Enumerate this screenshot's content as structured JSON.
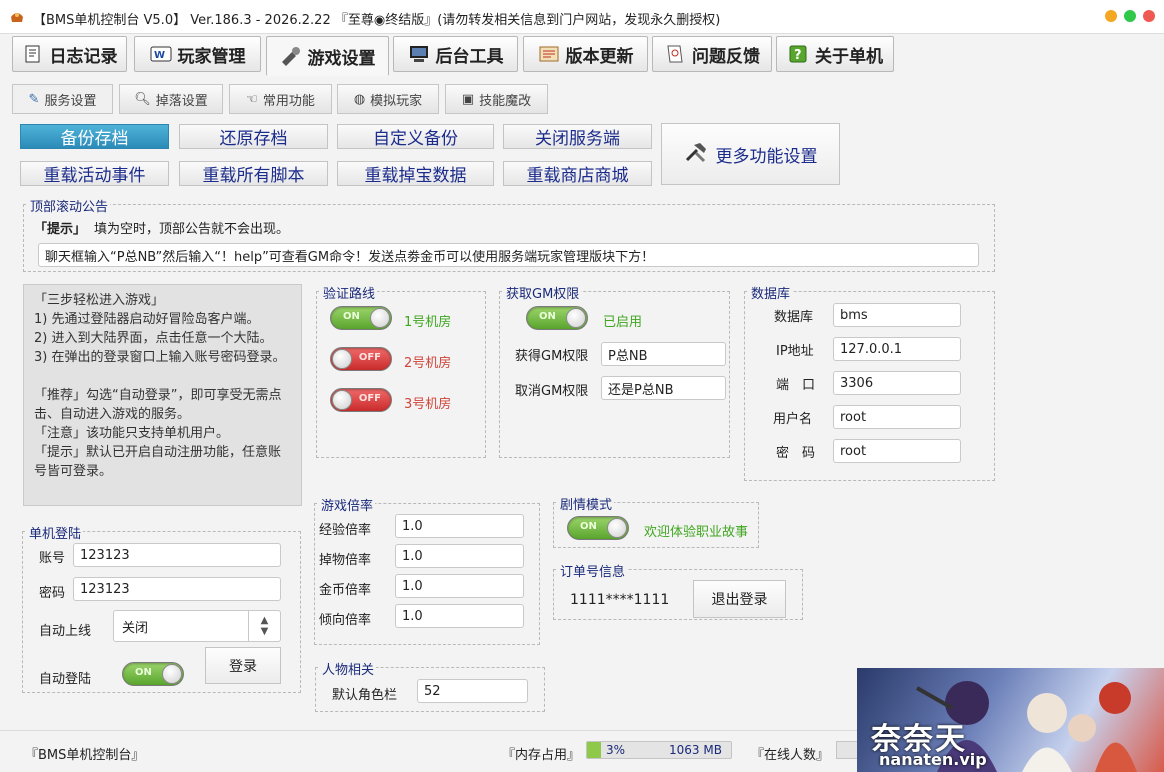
{
  "window": {
    "title": "【BMS单机控制台 V5.0】 Ver.186.3 - 2026.2.22 『至尊◉终结版』(请勿转发相关信息到门户网站，发现永久删授权)",
    "controls": {
      "minimize_color": "#f5a623",
      "maximize_color": "#2ec94a",
      "close_color": "#ee5a52"
    }
  },
  "main_tabs": [
    {
      "label": "日志记录",
      "icon": "log-icon"
    },
    {
      "label": "玩家管理",
      "icon": "player-icon"
    },
    {
      "label": "游戏设置",
      "icon": "game-settings-icon"
    },
    {
      "label": "后台工具",
      "icon": "computer-icon"
    },
    {
      "label": "版本更新",
      "icon": "update-icon"
    },
    {
      "label": "问题反馈",
      "icon": "feedback-icon"
    },
    {
      "label": "关于单机",
      "icon": "help-icon"
    }
  ],
  "sub_tabs": [
    {
      "label": "服务设置",
      "icon": "wrench-icon"
    },
    {
      "label": "掉落设置",
      "icon": "magnifier-icon"
    },
    {
      "label": "常用功能",
      "icon": "hand-icon"
    },
    {
      "label": "模拟玩家",
      "icon": "globe-icon"
    },
    {
      "label": "技能魔改",
      "icon": "image-icon"
    }
  ],
  "actions": {
    "backup": "备份存档",
    "restore": "还原存档",
    "custom_backup": "自定义备份",
    "close_server": "关闭服务端",
    "reload_events": "重载活动事件",
    "reload_scripts": "重载所有脚本",
    "reload_drops": "重载掉宝数据",
    "reload_shop": "重载商店商城",
    "more_settings": "更多功能设置"
  },
  "announcement": {
    "title": "顶部滚动公告",
    "hint_tag": "「提示」",
    "hint_text": "填为空时，顶部公告就不会出现。",
    "value": "聊天框输入“P总NB”然后输入“！help”可查看GM命令！发送点劵金币可以使用服务端玩家管理版块下方！"
  },
  "tips": [
    "「三步轻松进入游戏」",
    "1) 先通过登陆器启动好冒险岛客户端。",
    "2) 进入到大陆界面，点击任意一个大陆。",
    "3) 在弹出的登录窗口上输入账号密码登录。",
    "",
    "「推荐」勾选“自动登录”，即可享受无需点击、自动进入游戏的服务。",
    "「注意」该功能只支持单机用户。",
    "「提示」默认已开启自动注册功能，任意账号皆可登录。"
  ],
  "route": {
    "title": "验证路线",
    "items": [
      {
        "label": "1号机房",
        "state": "ON",
        "color": "#3fa61f"
      },
      {
        "label": "2号机房",
        "state": "OFF",
        "color": "#d0453a"
      },
      {
        "label": "3号机房",
        "state": "OFF",
        "color": "#d0453a"
      }
    ]
  },
  "gm": {
    "title": "获取GM权限",
    "toggle": "ON",
    "status": "已启用",
    "get_label": "获得GM权限",
    "get_value": "P总NB",
    "cancel_label": "取消GM权限",
    "cancel_value": "还是P总NB"
  },
  "database": {
    "title": "数据库",
    "fields": [
      {
        "label": "数据库",
        "value": "bms"
      },
      {
        "label": "IP地址",
        "value": "127.0.0.1"
      },
      {
        "label": "端　口",
        "value": "3306"
      },
      {
        "label": "用户名",
        "value": "root"
      },
      {
        "label": "密　码",
        "value": "root"
      }
    ]
  },
  "rates": {
    "title": "游戏倍率",
    "items": [
      {
        "label": "经验倍率",
        "value": "1.0"
      },
      {
        "label": "掉物倍率",
        "value": "1.0"
      },
      {
        "label": "金币倍率",
        "value": "1.0"
      },
      {
        "label": "倾向倍率",
        "value": "1.0"
      }
    ]
  },
  "character": {
    "title": "人物相关",
    "slot_label": "默认角色栏",
    "slot_value": "52"
  },
  "story": {
    "title": "剧情模式",
    "toggle": "ON",
    "text": "欢迎体验职业故事"
  },
  "order": {
    "title": "订单号信息",
    "number": "1111****1111",
    "logout": "退出登录"
  },
  "login": {
    "title": "单机登陆",
    "account_label": "账号",
    "account_value": "123123",
    "password_label": "密码",
    "password_value": "123123",
    "auto_online_label": "自动上线",
    "auto_online_value": "关闭",
    "auto_login_label": "自动登陆",
    "auto_login_toggle": "ON",
    "login_button": "登录"
  },
  "statusbar": {
    "app_name": "『BMS单机控制台』",
    "memory_label": "『内存占用』",
    "memory_percent": "3%",
    "memory_fill": 0.03,
    "memory_value": "1063 MB",
    "online_label": "『在线人数』"
  },
  "watermark": {
    "text": "奈奈天",
    "url": "nanaten.vip"
  }
}
